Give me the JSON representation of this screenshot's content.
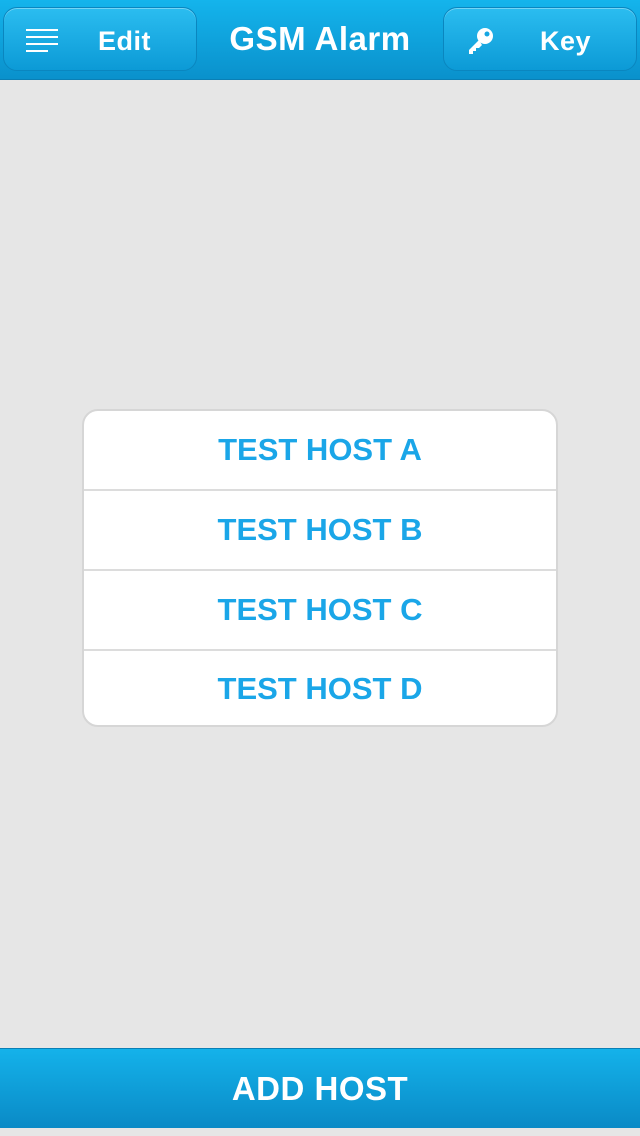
{
  "header": {
    "title": "GSM Alarm",
    "edit_label": "Edit",
    "key_label": "Key",
    "edit_icon": "menu-icon",
    "key_icon": "key-icon"
  },
  "hosts": [
    {
      "label": "TEST HOST A"
    },
    {
      "label": "TEST HOST B"
    },
    {
      "label": "TEST HOST C"
    },
    {
      "label": "TEST HOST D"
    }
  ],
  "footer": {
    "add_label": "ADD HOST"
  },
  "colors": {
    "accent": "#0e9fdc",
    "host_text": "#1aa6e8",
    "background": "#e6e6e6"
  }
}
